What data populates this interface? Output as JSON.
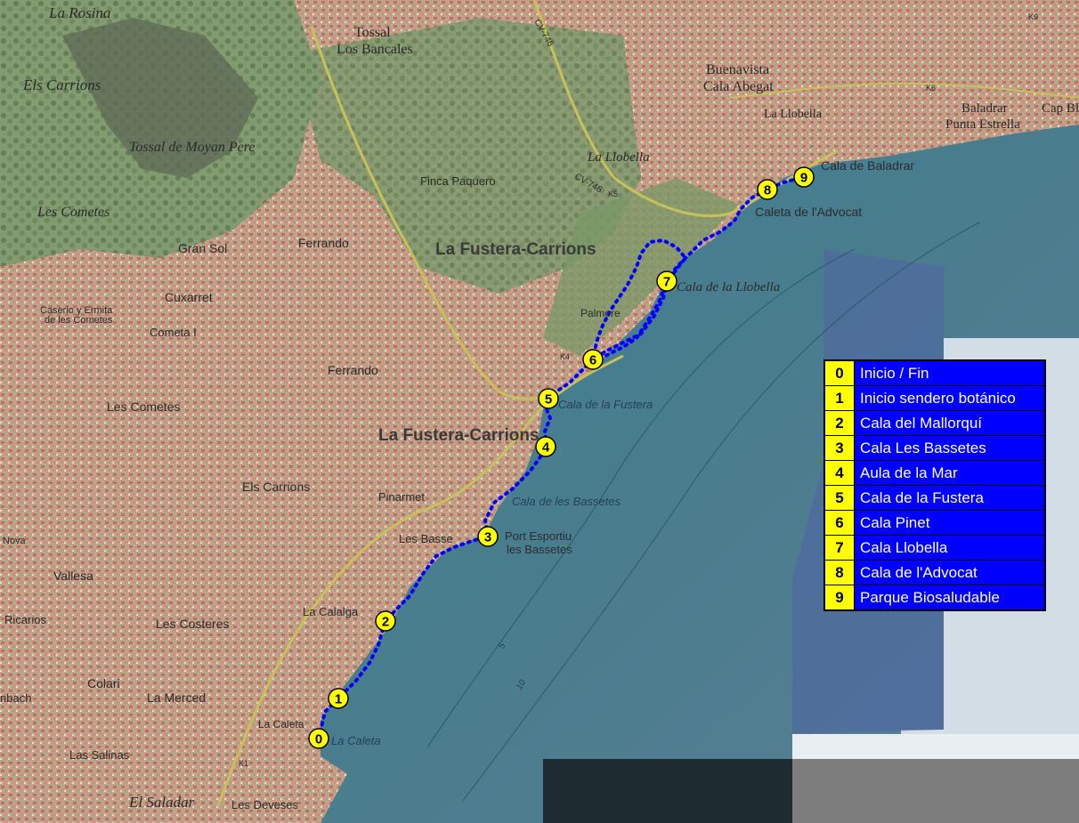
{
  "map": {
    "place_labels": [
      "La Rosina",
      "Els Carrions",
      "Tossal",
      "Los Bancales",
      "Tossal de Moyan Pere",
      "Les Cometes",
      "Gran Sol",
      "Cuxarret",
      "Caserio y Ermita",
      "de les Cometes",
      "Cometa I",
      "Ferrando",
      "Ferrando",
      "Finca Paquero",
      "La Fustera-Carrions",
      "La Fustera-Carrions",
      "Les Cometes",
      "Els Carrions",
      "Pinarmet",
      "Les Basse",
      "Vallesa",
      "Nova",
      "La Calalga",
      "Les Costeres",
      "Ricarios",
      "Colari",
      "La Merced",
      "nbach",
      "La Caleta",
      "Las Salinas",
      "El Saladar",
      "Les Deveses",
      "Buenavista",
      "Cala Abegat",
      "La Llobella",
      "Baladrar",
      "Punta Estrella",
      "Cap Bl",
      "La Llobella",
      "Palmore"
    ],
    "road_labels": [
      "CV-746",
      "CV-746",
      "K4",
      "K5",
      "K1",
      "K6",
      "K9"
    ],
    "water_labels": [
      "Cala de Baladrar",
      "Caleta de l'Advocat",
      "Cala de la Llobella",
      "Cala de la Fustera",
      "Cala de les Bassetes",
      "Port Esportiu",
      "les Bassetes",
      "La Caleta"
    ],
    "depth_labels": [
      "5",
      "10"
    ],
    "colors": {
      "route": "#0000ff",
      "marker_fill": "#ffff00",
      "marker_stroke": "#000000",
      "legend_bg": "#0000ff",
      "legend_num_bg": "#ffff00",
      "legend_text": "#ffffff"
    }
  },
  "waypoints": [
    {
      "num": "0"
    },
    {
      "num": "1"
    },
    {
      "num": "2"
    },
    {
      "num": "3"
    },
    {
      "num": "4"
    },
    {
      "num": "5"
    },
    {
      "num": "6"
    },
    {
      "num": "7"
    },
    {
      "num": "8"
    },
    {
      "num": "9"
    }
  ],
  "legend": {
    "items": [
      {
        "num": "0",
        "label": "Inicio / Fin"
      },
      {
        "num": "1",
        "label": "Inicio sendero botánico"
      },
      {
        "num": "2",
        "label": "Cala del Mallorquí"
      },
      {
        "num": "3",
        "label": "Cala Les Bassetes"
      },
      {
        "num": "4",
        "label": "Aula de la Mar"
      },
      {
        "num": "5",
        "label": "Cala de la Fustera"
      },
      {
        "num": "6",
        "label": "Cala Pinet"
      },
      {
        "num": "7",
        "label": "Cala Llobella"
      },
      {
        "num": "8",
        "label": "Cala de l'Advocat"
      },
      {
        "num": "9",
        "label": "Parque Biosaludable"
      }
    ]
  }
}
